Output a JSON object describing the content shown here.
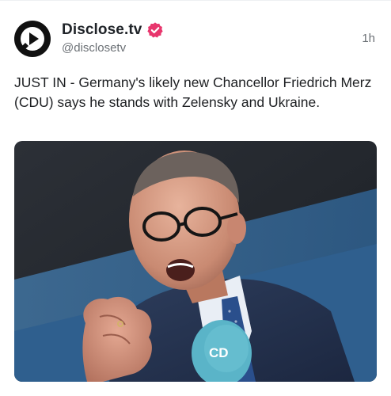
{
  "post": {
    "author_name": "Disclose.tv",
    "author_handle": "@disclosetv",
    "timestamp": "1h",
    "text": "JUST IN - Germany's likely new Chancellor Friedrich Merz (CDU) says he stands with Zelensky and Ukraine.",
    "verified": true,
    "avatar_icon": "play-logo-icon",
    "verified_icon": "verified-badge-icon",
    "accent_color": "#e8366d"
  },
  "media": {
    "microphone_label": "CD"
  }
}
